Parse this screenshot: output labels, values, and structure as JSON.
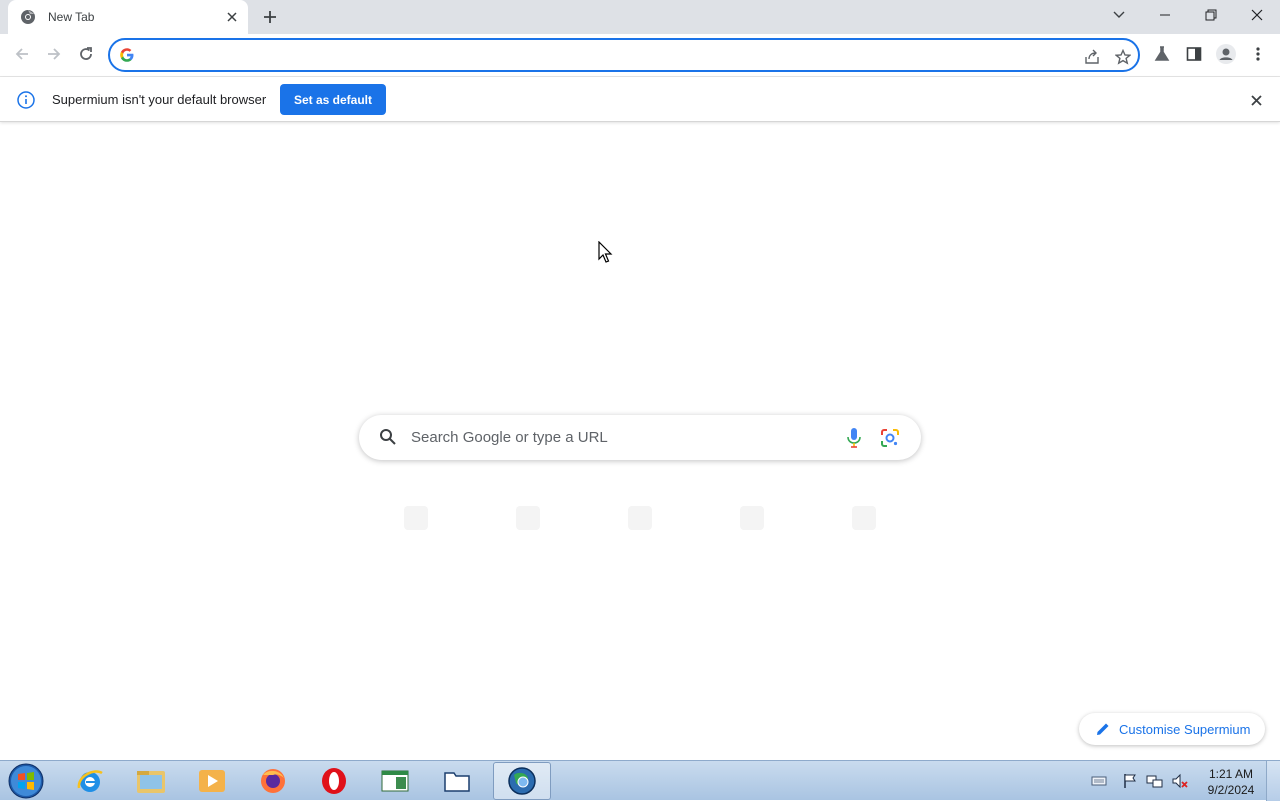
{
  "tab": {
    "title": "New Tab",
    "favicon": "chrome-icon",
    "close": "×"
  },
  "window_controls": [
    "tab-search-icon",
    "minimize-icon",
    "restore-icon",
    "close-icon"
  ],
  "toolbar": {
    "back": "back-icon",
    "forward": "forward-icon",
    "reload": "reload-icon",
    "omnibox_value": "",
    "omnibox_icons": [
      "share-icon",
      "bookmark-star-icon"
    ],
    "right_icons": [
      "labs-icon",
      "side-panel-icon",
      "profile-avatar-icon",
      "menu-kebab-icon"
    ]
  },
  "infobar": {
    "message": "Supermium isn't your default browser",
    "button_label": "Set as default"
  },
  "ntp": {
    "search_placeholder": "Search Google or type a URL",
    "shortcut_labels": [
      "",
      "",
      "",
      "",
      ""
    ],
    "customise_label": "Customise Supermium"
  },
  "taskbar": {
    "apps": [
      "internet-explorer-icon",
      "file-explorer-icon",
      "media-player-icon",
      "firefox-icon",
      "opera-icon",
      "notepad-icon",
      "folder-icon",
      "supermium-icon"
    ],
    "active_app": "supermium-icon",
    "clock_time": "1:21 AM",
    "clock_date": "9/2/2024"
  },
  "colors": {
    "accent": "#1a73e8",
    "tabstrip": "#dee1e6",
    "taskbar": "#b9d1ea"
  }
}
